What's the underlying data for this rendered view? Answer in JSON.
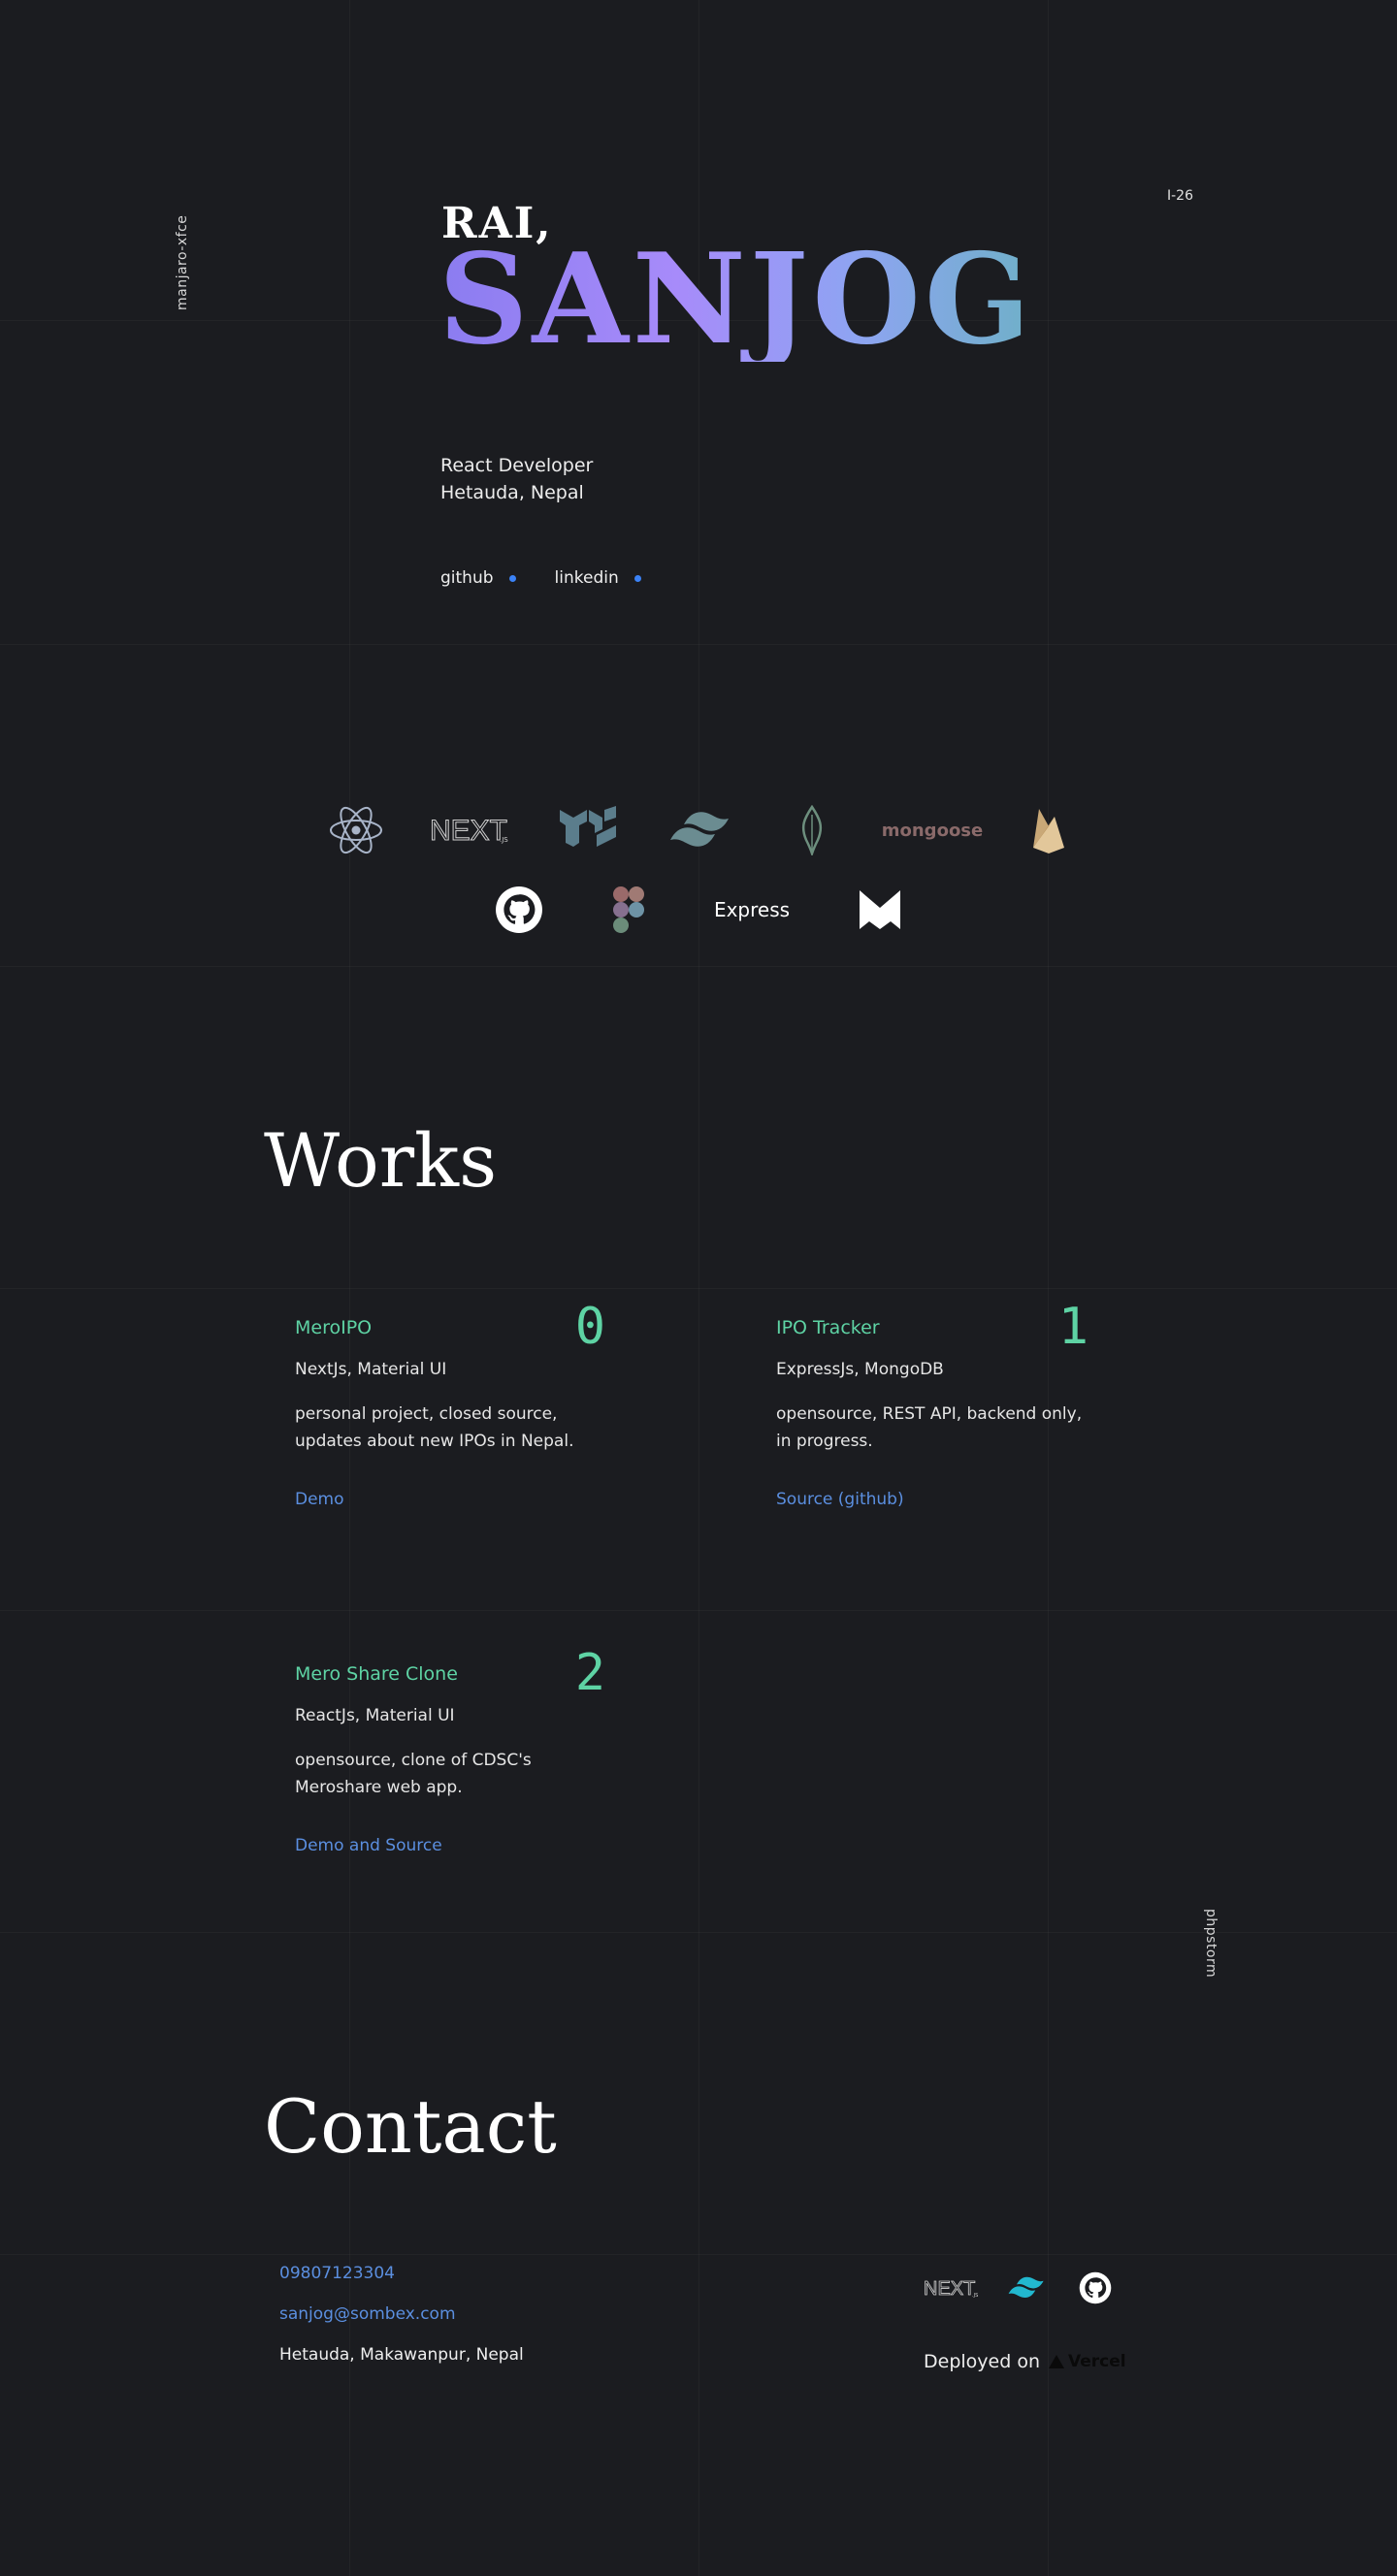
{
  "side": {
    "left_label": "manjaro-xfce",
    "right_label": "phpstorm",
    "corner": "I-26"
  },
  "hero": {
    "first_name": "RAI,",
    "last_name": "SANJOG",
    "role": "React Developer",
    "location": "Hetauda, Nepal",
    "links": [
      {
        "label": "github"
      },
      {
        "label": "linkedin"
      }
    ]
  },
  "tech": {
    "row1": [
      "react-icon",
      "nextjs-icon",
      "material-ui-icon",
      "tailwind-icon",
      "mongodb-icon",
      "mongoose",
      "firebase-icon"
    ],
    "mongoose_label": "mongoose",
    "row2": [
      "github-icon",
      "figma-icon",
      "Express",
      "medusa-icon"
    ],
    "express_label": "Express"
  },
  "works": {
    "title": "Works",
    "items": [
      {
        "num": "0",
        "title": "MeroIPO",
        "stack": "NextJs, Material UI",
        "desc": "personal project, closed source, updates about new IPOs in Nepal.",
        "link": "Demo"
      },
      {
        "num": "1",
        "title": "IPO Tracker",
        "stack": "ExpressJs, MongoDB",
        "desc": "opensource, REST API, backend only, in progress.",
        "link": "Source (github)"
      },
      {
        "num": "2",
        "title": "Mero Share Clone",
        "stack": "ReactJs, Material UI",
        "desc": "opensource, clone of CDSC's Meroshare web app.",
        "link": "Demo and Source"
      }
    ]
  },
  "contact": {
    "title": "Contact",
    "phone": "09807123304",
    "email": "sanjog@sombex.com",
    "address": "Hetauda, Makawanpur, Nepal",
    "deployed_label": "Deployed on",
    "vercel_label": "Vercel"
  },
  "colors": {
    "accent_green": "#5ed3a4",
    "link_blue": "#5b8fe0",
    "background": "#1b1c20"
  }
}
